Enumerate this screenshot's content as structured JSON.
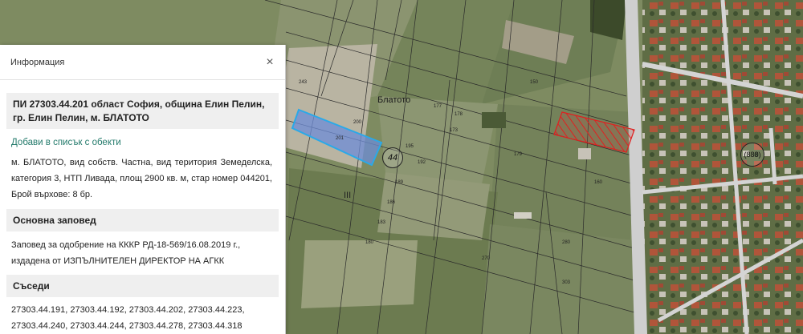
{
  "map": {
    "place_label": "Блатото",
    "route_badge": "44",
    "route_badge_2": "(888)",
    "roman_numeral": "III",
    "parcel_numbers": [
      "201",
      "243",
      "177",
      "178",
      "195",
      "192",
      "189",
      "186",
      "183",
      "180",
      "179",
      "270",
      "303",
      "150",
      "160",
      "280",
      "200",
      "173"
    ],
    "colors": {
      "selected_parcel_fill": "#6f8fd6",
      "selected_parcel_border": "#2aa9e8",
      "hatched_parcel": "#e02020",
      "road": "#cfcfcf",
      "field": "#7e8b61"
    }
  },
  "panel": {
    "title": "Информация",
    "close_label": "×",
    "object_title": "ПИ 27303.44.201 област София, община Елин Пелин, гр. Елин Пелин, м. БЛАТОТО",
    "add_link": "Добави в списък с обекти",
    "description": "м. БЛАТОТО, вид собств. Частна, вид територия Земеделска, категория 3, НТП Ливада, площ 2900 кв. м, стар номер 044201, Брой върхове: 8 бр.",
    "order_heading": "Основна заповед",
    "order_text": "Заповед за одобрение на КККР РД-18-569/16.08.2019 г., издадена от ИЗПЪЛНИТЕЛЕН ДИРЕКТОР НА АГКК",
    "neighbors_heading": "Съседи",
    "neighbors_text": "27303.44.191, 27303.44.192, 27303.44.202, 27303.44.223, 27303.44.240, 27303.44.244, 27303.44.278, 27303.44.318"
  }
}
